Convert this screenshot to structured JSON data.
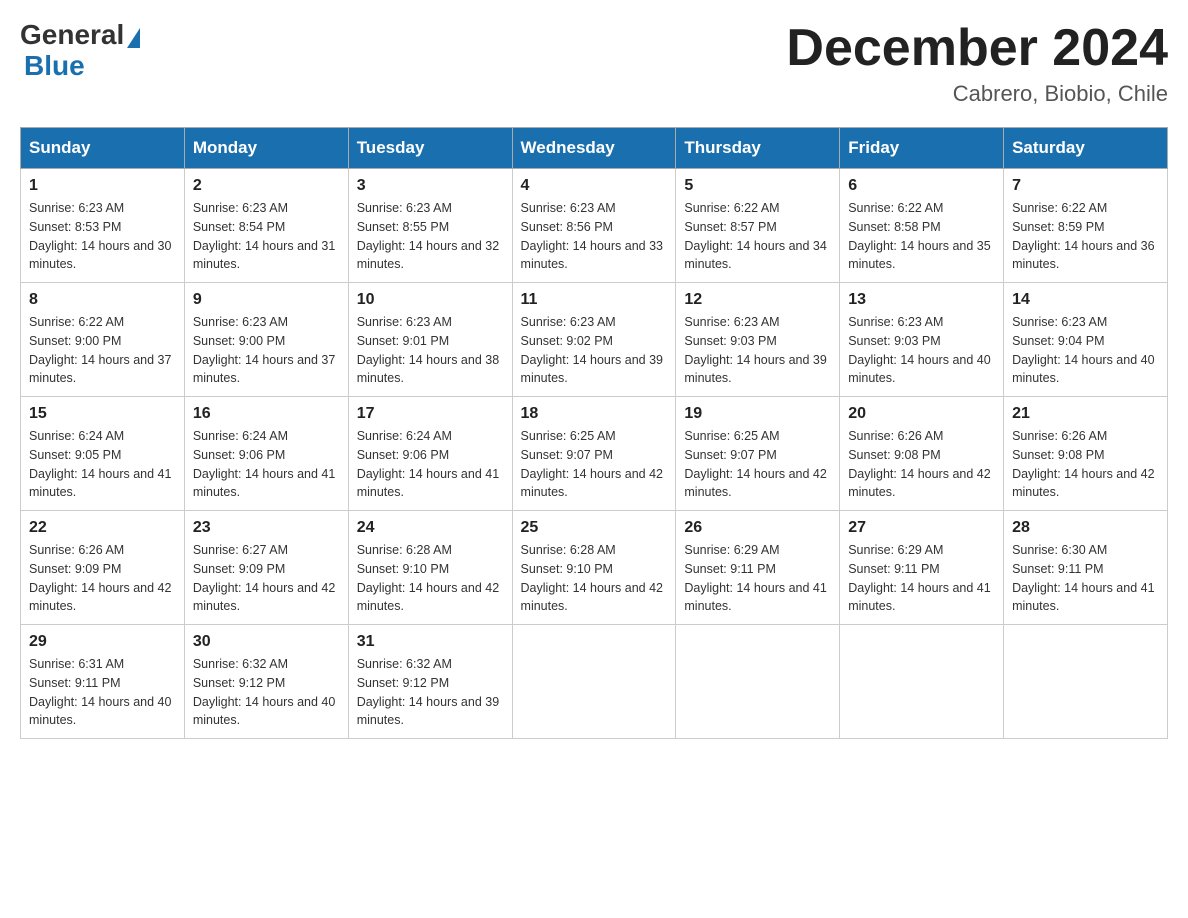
{
  "logo": {
    "general": "General",
    "arrow": "▶",
    "blue": "Blue"
  },
  "title": "December 2024",
  "subtitle": "Cabrero, Biobio, Chile",
  "headers": [
    "Sunday",
    "Monday",
    "Tuesday",
    "Wednesday",
    "Thursday",
    "Friday",
    "Saturday"
  ],
  "weeks": [
    [
      {
        "day": "1",
        "sunrise": "6:23 AM",
        "sunset": "8:53 PM",
        "daylight": "14 hours and 30 minutes."
      },
      {
        "day": "2",
        "sunrise": "6:23 AM",
        "sunset": "8:54 PM",
        "daylight": "14 hours and 31 minutes."
      },
      {
        "day": "3",
        "sunrise": "6:23 AM",
        "sunset": "8:55 PM",
        "daylight": "14 hours and 32 minutes."
      },
      {
        "day": "4",
        "sunrise": "6:23 AM",
        "sunset": "8:56 PM",
        "daylight": "14 hours and 33 minutes."
      },
      {
        "day": "5",
        "sunrise": "6:22 AM",
        "sunset": "8:57 PM",
        "daylight": "14 hours and 34 minutes."
      },
      {
        "day": "6",
        "sunrise": "6:22 AM",
        "sunset": "8:58 PM",
        "daylight": "14 hours and 35 minutes."
      },
      {
        "day": "7",
        "sunrise": "6:22 AM",
        "sunset": "8:59 PM",
        "daylight": "14 hours and 36 minutes."
      }
    ],
    [
      {
        "day": "8",
        "sunrise": "6:22 AM",
        "sunset": "9:00 PM",
        "daylight": "14 hours and 37 minutes."
      },
      {
        "day": "9",
        "sunrise": "6:23 AM",
        "sunset": "9:00 PM",
        "daylight": "14 hours and 37 minutes."
      },
      {
        "day": "10",
        "sunrise": "6:23 AM",
        "sunset": "9:01 PM",
        "daylight": "14 hours and 38 minutes."
      },
      {
        "day": "11",
        "sunrise": "6:23 AM",
        "sunset": "9:02 PM",
        "daylight": "14 hours and 39 minutes."
      },
      {
        "day": "12",
        "sunrise": "6:23 AM",
        "sunset": "9:03 PM",
        "daylight": "14 hours and 39 minutes."
      },
      {
        "day": "13",
        "sunrise": "6:23 AM",
        "sunset": "9:03 PM",
        "daylight": "14 hours and 40 minutes."
      },
      {
        "day": "14",
        "sunrise": "6:23 AM",
        "sunset": "9:04 PM",
        "daylight": "14 hours and 40 minutes."
      }
    ],
    [
      {
        "day": "15",
        "sunrise": "6:24 AM",
        "sunset": "9:05 PM",
        "daylight": "14 hours and 41 minutes."
      },
      {
        "day": "16",
        "sunrise": "6:24 AM",
        "sunset": "9:06 PM",
        "daylight": "14 hours and 41 minutes."
      },
      {
        "day": "17",
        "sunrise": "6:24 AM",
        "sunset": "9:06 PM",
        "daylight": "14 hours and 41 minutes."
      },
      {
        "day": "18",
        "sunrise": "6:25 AM",
        "sunset": "9:07 PM",
        "daylight": "14 hours and 42 minutes."
      },
      {
        "day": "19",
        "sunrise": "6:25 AM",
        "sunset": "9:07 PM",
        "daylight": "14 hours and 42 minutes."
      },
      {
        "day": "20",
        "sunrise": "6:26 AM",
        "sunset": "9:08 PM",
        "daylight": "14 hours and 42 minutes."
      },
      {
        "day": "21",
        "sunrise": "6:26 AM",
        "sunset": "9:08 PM",
        "daylight": "14 hours and 42 minutes."
      }
    ],
    [
      {
        "day": "22",
        "sunrise": "6:26 AM",
        "sunset": "9:09 PM",
        "daylight": "14 hours and 42 minutes."
      },
      {
        "day": "23",
        "sunrise": "6:27 AM",
        "sunset": "9:09 PM",
        "daylight": "14 hours and 42 minutes."
      },
      {
        "day": "24",
        "sunrise": "6:28 AM",
        "sunset": "9:10 PM",
        "daylight": "14 hours and 42 minutes."
      },
      {
        "day": "25",
        "sunrise": "6:28 AM",
        "sunset": "9:10 PM",
        "daylight": "14 hours and 42 minutes."
      },
      {
        "day": "26",
        "sunrise": "6:29 AM",
        "sunset": "9:11 PM",
        "daylight": "14 hours and 41 minutes."
      },
      {
        "day": "27",
        "sunrise": "6:29 AM",
        "sunset": "9:11 PM",
        "daylight": "14 hours and 41 minutes."
      },
      {
        "day": "28",
        "sunrise": "6:30 AM",
        "sunset": "9:11 PM",
        "daylight": "14 hours and 41 minutes."
      }
    ],
    [
      {
        "day": "29",
        "sunrise": "6:31 AM",
        "sunset": "9:11 PM",
        "daylight": "14 hours and 40 minutes."
      },
      {
        "day": "30",
        "sunrise": "6:32 AM",
        "sunset": "9:12 PM",
        "daylight": "14 hours and 40 minutes."
      },
      {
        "day": "31",
        "sunrise": "6:32 AM",
        "sunset": "9:12 PM",
        "daylight": "14 hours and 39 minutes."
      },
      null,
      null,
      null,
      null
    ]
  ]
}
